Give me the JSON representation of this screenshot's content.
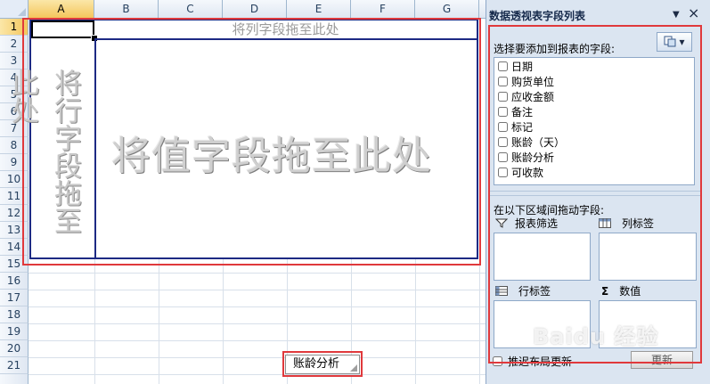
{
  "sheet": {
    "columns": [
      "A",
      "B",
      "C",
      "D",
      "E",
      "F",
      "G"
    ],
    "rows": [
      "1",
      "2",
      "3",
      "4",
      "5",
      "6",
      "7",
      "8",
      "9",
      "10",
      "11",
      "12",
      "13",
      "14",
      "15",
      "16",
      "17",
      "18",
      "19",
      "20",
      "21"
    ],
    "selected_column": "A",
    "selected_row": "1",
    "pivot": {
      "column_drop_text": "将列字段拖至此处",
      "row_drop_text": "将行字段拖至此处",
      "value_drop_text": "将值字段拖至此处"
    },
    "active_tab": "账龄分析"
  },
  "pane": {
    "title": "数据透视表字段列表",
    "dropdown_glyph": "▼",
    "close_glyph": "×",
    "layout_glyph": "▾",
    "choose_fields_label": "选择要添加到报表的字段:",
    "fields": [
      "日期",
      "购货单位",
      "应收金额",
      "备注",
      "标记",
      "账龄（天）",
      "账龄分析",
      "可收款"
    ],
    "drag_label": "在以下区域间拖动字段:",
    "areas": {
      "filter": "报表筛选",
      "columns": "列标签",
      "rows": "行标签",
      "values": "数值"
    },
    "values_icon": "Σ",
    "defer_label": "推迟布局更新",
    "update_button": "更新"
  },
  "watermark": "Baidu 经验",
  "colors": {
    "pivot_border": "#1d2a84",
    "highlight": "#e0393c",
    "pane_bg": "#dbe5f1"
  }
}
